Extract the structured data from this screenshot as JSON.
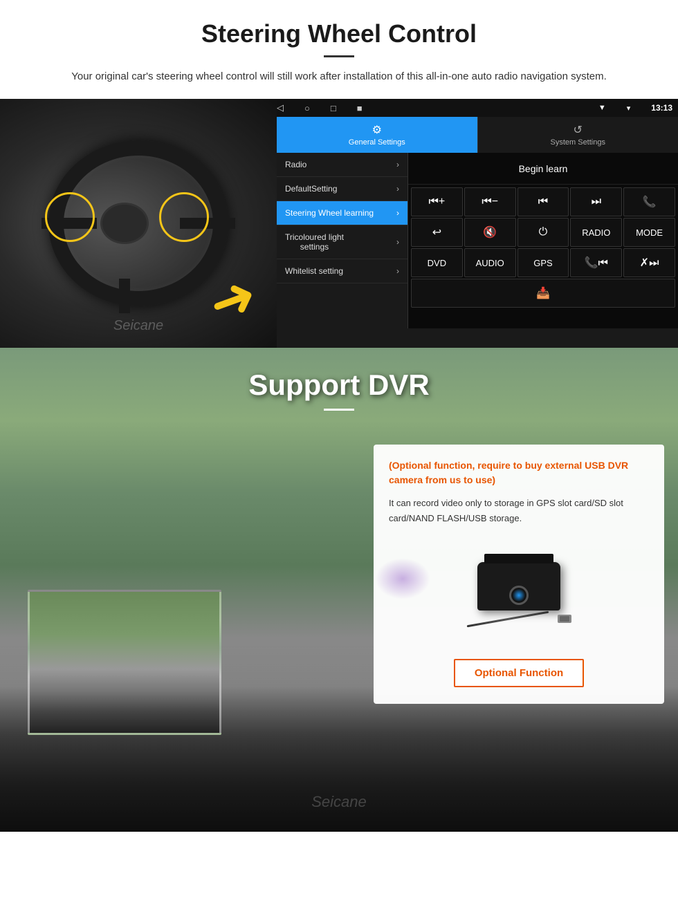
{
  "page": {
    "steering_section": {
      "title": "Steering Wheel Control",
      "subtitle": "Your original car's steering wheel control will still work after installation of this all-in-one auto radio navigation system."
    },
    "android_ui": {
      "status_bar": {
        "signal_icon": "▼",
        "wifi_icon": "▾",
        "time": "13:13"
      },
      "nav_bar": {
        "back": "◁",
        "home": "○",
        "recent": "□",
        "menu": "■"
      },
      "tabs": [
        {
          "icon": "⚙",
          "label": "General Settings",
          "active": true
        },
        {
          "icon": "🔁",
          "label": "System Settings",
          "active": false
        }
      ],
      "menu_items": [
        {
          "label": "Radio",
          "active": false
        },
        {
          "label": "DefaultSetting",
          "active": false
        },
        {
          "label": "Steering Wheel learning",
          "active": true
        },
        {
          "label": "Tricoloured light settings",
          "active": false
        },
        {
          "label": "Whitelist setting",
          "active": false
        }
      ],
      "begin_learn_label": "Begin learn",
      "control_buttons": [
        [
          "⏮+",
          "⏮—",
          "⏮|",
          "⏭|",
          "📞"
        ],
        [
          "↩",
          "🔇×",
          "⏻",
          "RADIO",
          "MODE"
        ],
        [
          "DVD",
          "AUDIO",
          "GPS",
          "📞⏮|",
          "✗⏭|"
        ],
        [
          "📥"
        ]
      ]
    },
    "dvr_section": {
      "title": "Support DVR",
      "optional_warning": "(Optional function, require to buy external USB DVR camera from us to use)",
      "description": "It can record video only to storage in GPS slot card/SD slot card/NAND FLASH/USB storage.",
      "optional_function_label": "Optional Function"
    }
  }
}
